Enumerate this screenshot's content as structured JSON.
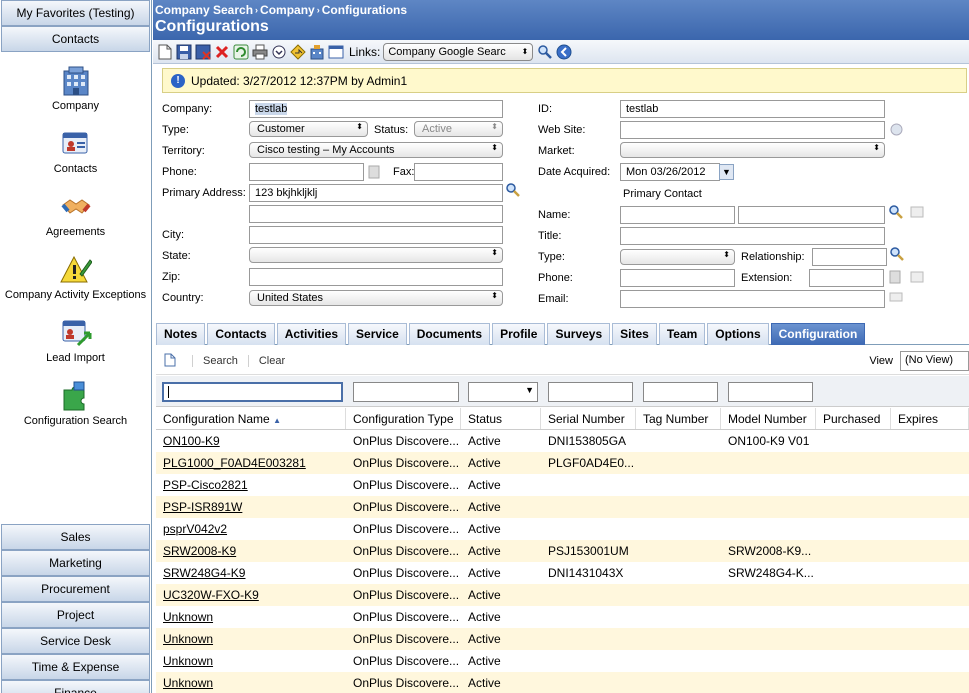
{
  "sidebar": {
    "top_buttons": [
      "My Favorites (Testing)",
      "Contacts"
    ],
    "items": [
      {
        "label": "Company",
        "icon": "building-icon"
      },
      {
        "label": "Contacts",
        "icon": "contacts-card-icon"
      },
      {
        "label": "Agreements",
        "icon": "handshake-icon"
      },
      {
        "label": "Company Activity Exceptions",
        "icon": "warning-pencil-icon"
      },
      {
        "label": "Lead Import",
        "icon": "lead-import-icon"
      },
      {
        "label": "Configuration Search",
        "icon": "puzzle-icon"
      }
    ],
    "bottom_buttons": [
      "Sales",
      "Marketing",
      "Procurement",
      "Project",
      "Service Desk",
      "Time & Expense",
      "Finance"
    ]
  },
  "header": {
    "breadcrumb": [
      "Company Search",
      "Company",
      "Configurations"
    ],
    "title": "Configurations"
  },
  "toolbar": {
    "links_label": "Links:",
    "links_value": "Company Google Searc"
  },
  "notice": {
    "text": "Updated: 3/27/2012 12:37PM by Admin1"
  },
  "form": {
    "company_label": "Company:",
    "company_value": "testlab",
    "type_label": "Type:",
    "type_value": "Customer",
    "status_label": "Status:",
    "status_value": "Active",
    "territory_label": "Territory:",
    "territory_value": "Cisco testing – My Accounts",
    "phone_label": "Phone:",
    "phone_value": "",
    "fax_label": "Fax:",
    "fax_value": "",
    "primary_address_label": "Primary Address:",
    "address1_value": "123 bkjhkljklj",
    "address2_value": "",
    "city_label": "City:",
    "city_value": "",
    "state_label": "State:",
    "state_value": "",
    "zip_label": "Zip:",
    "zip_value": "",
    "country_label": "Country:",
    "country_value": "United States",
    "id_label": "ID:",
    "id_value": "testlab",
    "website_label": "Web Site:",
    "website_value": "",
    "market_label": "Market:",
    "market_value": "",
    "date_acquired_label": "Date Acquired:",
    "date_acquired_value": "Mon 03/26/2012",
    "primary_contact_heading": "Primary Contact",
    "name_label": "Name:",
    "name_first_value": "",
    "name_last_value": "",
    "title_label": "Title:",
    "title_value": "",
    "contact_type_label": "Type:",
    "contact_type_value": "",
    "relationship_label": "Relationship:",
    "relationship_value": "",
    "contact_phone_label": "Phone:",
    "contact_phone_value": "",
    "extension_label": "Extension:",
    "extension_value": "",
    "email_label": "Email:",
    "email_value": ""
  },
  "tabs": [
    "Notes",
    "Contacts",
    "Activities",
    "Service",
    "Documents",
    "Profile",
    "Surveys",
    "Sites",
    "Team",
    "Options",
    "Configuration"
  ],
  "active_tab": "Configuration",
  "grid_toolbar": {
    "search_label": "Search",
    "clear_label": "Clear",
    "view_label": "View",
    "view_value": "(No View)"
  },
  "grid": {
    "columns": [
      "Configuration Name",
      "Configuration Type",
      "Status",
      "Serial Number",
      "Tag Number",
      "Model Number",
      "Purchased",
      "Expires"
    ],
    "sort_indicator": "▲",
    "rows": [
      [
        "ON100-K9",
        "OnPlus Discovere...",
        "Active",
        "DNI153805GA",
        "",
        "ON100-K9 V01",
        "",
        ""
      ],
      [
        "PLG1000_F0AD4E003281",
        "OnPlus Discovere...",
        "Active",
        "PLGF0AD4E0...",
        "",
        "",
        "",
        ""
      ],
      [
        "PSP-Cisco2821",
        "OnPlus Discovere...",
        "Active",
        "",
        "",
        "",
        "",
        ""
      ],
      [
        "PSP-ISR891W",
        "OnPlus Discovere...",
        "Active",
        "",
        "",
        "",
        "",
        ""
      ],
      [
        "psprV042v2",
        "OnPlus Discovere...",
        "Active",
        "",
        "",
        "",
        "",
        ""
      ],
      [
        "SRW2008-K9",
        "OnPlus Discovere...",
        "Active",
        "PSJ153001UM",
        "",
        "SRW2008-K9...",
        "",
        ""
      ],
      [
        "SRW248G4-K9",
        "OnPlus Discovere...",
        "Active",
        "DNI1431043X",
        "",
        "SRW248G4-K...",
        "",
        ""
      ],
      [
        "UC320W-FXO-K9",
        "OnPlus Discovere...",
        "Active",
        "",
        "",
        "",
        "",
        ""
      ],
      [
        "Unknown",
        "OnPlus Discovere...",
        "Active",
        "",
        "",
        "",
        "",
        ""
      ],
      [
        "Unknown",
        "OnPlus Discovere...",
        "Active",
        "",
        "",
        "",
        "",
        ""
      ],
      [
        "Unknown",
        "OnPlus Discovere...",
        "Active",
        "",
        "",
        "",
        "",
        ""
      ],
      [
        "Unknown",
        "OnPlus Discovere...",
        "Active",
        "",
        "",
        "",
        "",
        ""
      ]
    ]
  }
}
